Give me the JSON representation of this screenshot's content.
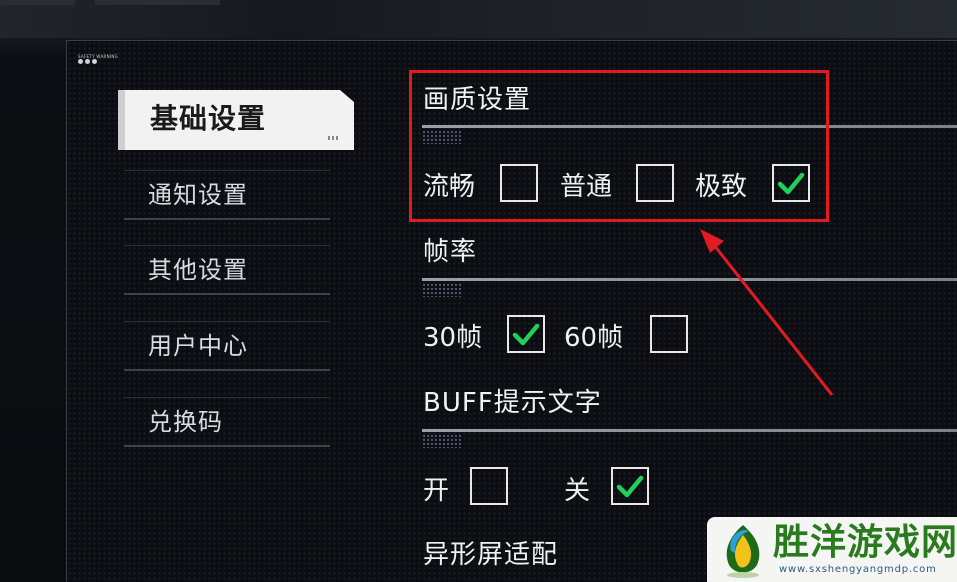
{
  "panel": {
    "logo_text": "SAFETY WARNING"
  },
  "sidebar": {
    "items": [
      {
        "label": "基础设置",
        "active": true
      },
      {
        "label": "通知设置",
        "active": false
      },
      {
        "label": "其他设置",
        "active": false
      },
      {
        "label": "用户中心",
        "active": false
      },
      {
        "label": "兑换码",
        "active": false
      }
    ]
  },
  "settings": {
    "quality": {
      "title": "画质设置",
      "options": [
        {
          "label": "流畅",
          "checked": false
        },
        {
          "label": "普通",
          "checked": false
        },
        {
          "label": "极致",
          "checked": true
        }
      ]
    },
    "framerate": {
      "title": "帧率",
      "options": [
        {
          "label": "30帧",
          "checked": true
        },
        {
          "label": "60帧",
          "checked": false
        }
      ]
    },
    "buff_text": {
      "title": "BUFF提示文字",
      "options": [
        {
          "label": "开",
          "checked": false
        },
        {
          "label": "关",
          "checked": true
        }
      ]
    },
    "notch": {
      "title": "异形屏适配"
    }
  },
  "annotation": {
    "highlight_color": "#e21a22"
  },
  "watermark": {
    "name": "胜洋游戏网",
    "url": "www.sxshengyangmdp.com"
  },
  "colors": {
    "check": "#1fd05a",
    "checkbox_border": "#e8e8e8",
    "active_tab": "#f2f2f2"
  }
}
